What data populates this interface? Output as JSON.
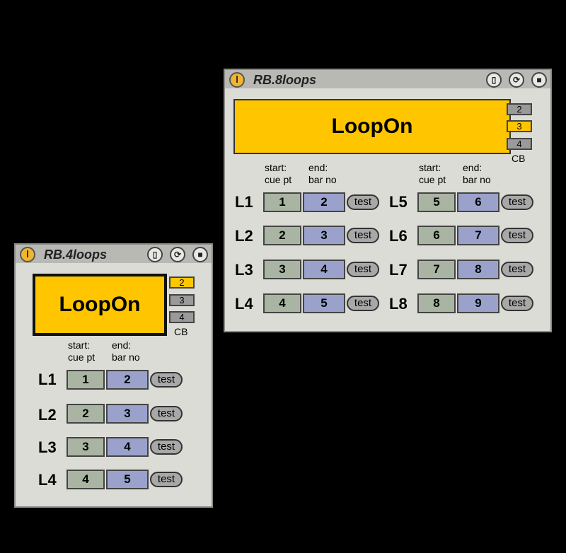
{
  "dev8": {
    "title": "RB.8loops",
    "loop_label": "LoopOn",
    "cb": [
      "2",
      "3",
      "4"
    ],
    "cb_selected": 1,
    "cb_label": "CB",
    "hdr_start": [
      "start:",
      "cue pt"
    ],
    "hdr_end": [
      "end:",
      "bar no"
    ],
    "test_label": "test",
    "rows": [
      {
        "label": "L1",
        "start": "1",
        "end": "2"
      },
      {
        "label": "L2",
        "start": "2",
        "end": "3"
      },
      {
        "label": "L3",
        "start": "3",
        "end": "4"
      },
      {
        "label": "L4",
        "start": "4",
        "end": "5"
      },
      {
        "label": "L5",
        "start": "5",
        "end": "6"
      },
      {
        "label": "L6",
        "start": "6",
        "end": "7"
      },
      {
        "label": "L7",
        "start": "7",
        "end": "8"
      },
      {
        "label": "L8",
        "start": "8",
        "end": "9"
      }
    ]
  },
  "dev4": {
    "title": "RB.4loops",
    "loop_label": "LoopOn",
    "cb": [
      "2",
      "3",
      "4"
    ],
    "cb_selected": 0,
    "cb_label": "CB",
    "hdr_start": [
      "start:",
      "cue pt"
    ],
    "hdr_end": [
      "end:",
      "bar no"
    ],
    "test_label": "test",
    "rows": [
      {
        "label": "L1",
        "start": "1",
        "end": "2"
      },
      {
        "label": "L2",
        "start": "2",
        "end": "3"
      },
      {
        "label": "L3",
        "start": "3",
        "end": "4"
      },
      {
        "label": "L4",
        "start": "4",
        "end": "5"
      }
    ]
  },
  "colors": {
    "accent": "#ffc600",
    "start_box": "#a9b5a2",
    "end_box": "#9aa2cc",
    "panel": "#dcdcd6"
  },
  "icons": [
    "power-icon",
    "fold-icon",
    "refresh-icon",
    "save-icon"
  ]
}
